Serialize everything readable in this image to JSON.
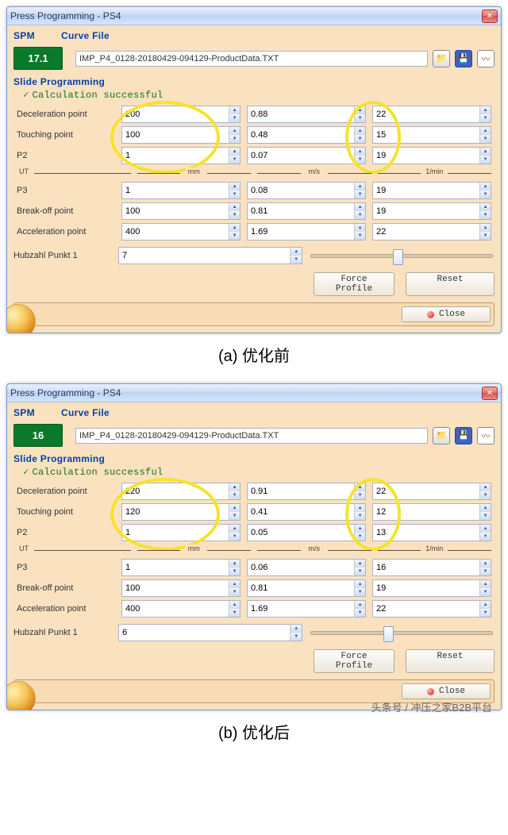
{
  "caption_a": "(a)  优化前",
  "caption_b": "(b)  优化后",
  "attribution": "头条号 / 冲压之家B2B平台",
  "dlg1": {
    "title": "Press Programming - PS4",
    "spm_label": "SPM",
    "curve_label": "Curve File",
    "spm_value": "17.1",
    "curve_file": "IMP_P4_0128-20180429-094129-ProductData.TXT",
    "section": "Slide Programming",
    "calc_msg": "Calculation successful",
    "labels": {
      "decel": "Deceleration point",
      "touch": "Touching point",
      "p2": "P2",
      "p3": "P3",
      "break": "Break-off point",
      "accel": "Acceleration point",
      "hubzahl": "Hubzahl Punkt 1"
    },
    "units": {
      "ut": "UT",
      "mm": "mm",
      "ms": "m/s",
      "imin": "1/min"
    },
    "vals": {
      "decel": {
        "a": "200",
        "b": "0.88",
        "c": "22"
      },
      "touch": {
        "a": "100",
        "b": "0.48",
        "c": "15"
      },
      "p2": {
        "a": "1",
        "b": "0.07",
        "c": "19"
      },
      "p3": {
        "a": "1",
        "b": "0.08",
        "c": "19"
      },
      "break": {
        "a": "100",
        "b": "0.81",
        "c": "19"
      },
      "accel": {
        "a": "400",
        "b": "1.69",
        "c": "22"
      },
      "hubzahl": "7"
    },
    "btn_force": "Force\nProfile",
    "btn_reset": "Reset",
    "btn_close": "Close"
  },
  "dlg2": {
    "title": "Press Programming - PS4",
    "spm_label": "SPM",
    "curve_label": "Curve File",
    "spm_value": "16",
    "curve_file": "IMP_P4_0128-20180429-094129-ProductData.TXT",
    "section": "Slide Programming",
    "calc_msg": "Calculation successful",
    "labels": {
      "decel": "Deceleration point",
      "touch": "Touching point",
      "p2": "P2",
      "p3": "P3",
      "break": "Break-off point",
      "accel": "Acceleration point",
      "hubzahl": "Hubzahl Punkt 1"
    },
    "units": {
      "ut": "UT",
      "mm": "mm",
      "ms": "m/s",
      "imin": "1/min"
    },
    "vals": {
      "decel": {
        "a": "220",
        "b": "0.91",
        "c": "22"
      },
      "touch": {
        "a": "120",
        "b": "0.41",
        "c": "12"
      },
      "p2": {
        "a": "1",
        "b": "0.05",
        "c": "13"
      },
      "p3": {
        "a": "1",
        "b": "0.06",
        "c": "16"
      },
      "break": {
        "a": "100",
        "b": "0.81",
        "c": "19"
      },
      "accel": {
        "a": "400",
        "b": "1.69",
        "c": "22"
      },
      "hubzahl": "6"
    },
    "btn_force": "Force\nProfile",
    "btn_reset": "Reset",
    "btn_close": "Close"
  }
}
